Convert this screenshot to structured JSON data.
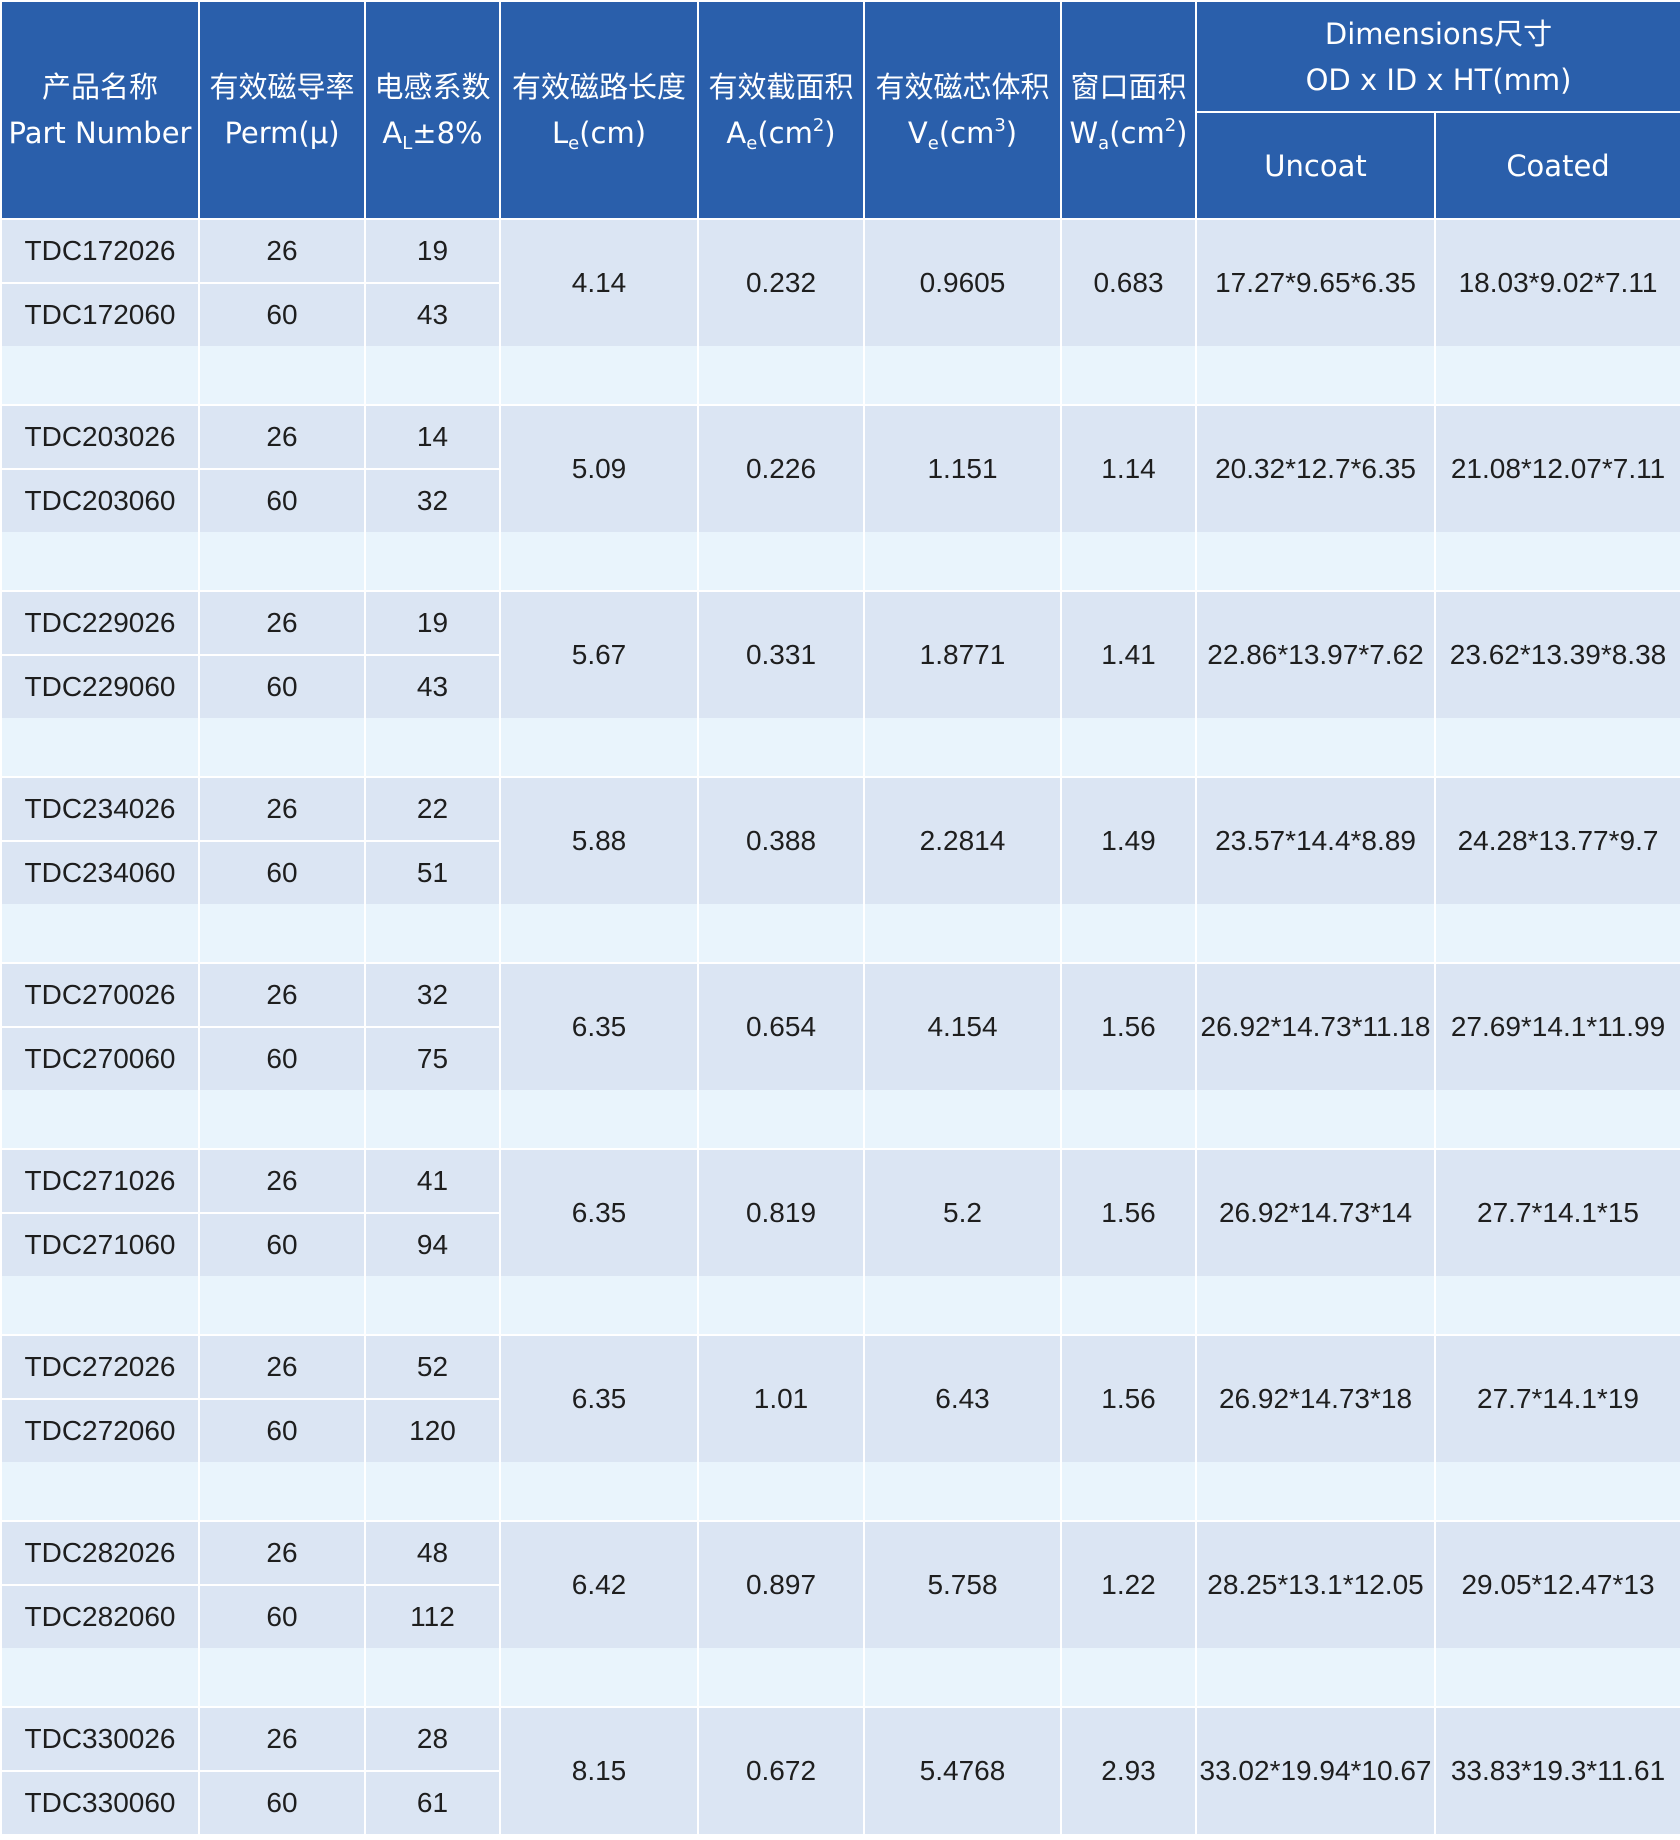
{
  "header": {
    "part": {
      "cn": "产品名称",
      "en": "Part Number"
    },
    "perm": {
      "cn": "有效磁导率",
      "en": "Perm(μ)"
    },
    "al": {
      "cn": "电感系数",
      "sym": "A",
      "sub": "L",
      "rest": "±8%"
    },
    "le": {
      "cn": "有效磁路长度",
      "sym": "L",
      "sub": "e",
      "rest": "(cm)"
    },
    "ae": {
      "cn": "有效截面积",
      "sym": "A",
      "sub": "e",
      "rest": "(cm",
      "sup": "2",
      "close": ")"
    },
    "ve": {
      "cn": "有效磁芯体积",
      "sym": "V",
      "sub": "e",
      "rest": "(cm",
      "sup": "3",
      "close": ")"
    },
    "wa": {
      "cn": "窗口面积",
      "sym": "W",
      "sub": "a",
      "rest": "(cm",
      "sup": "2",
      "close": ")"
    },
    "dims": {
      "line1": "Dimensions尺寸",
      "line2": "OD x ID x HT(mm)"
    },
    "uncoat": "Uncoat",
    "coated": "Coated"
  },
  "groups": [
    {
      "parts": [
        {
          "part": "TDC172026",
          "perm": "26",
          "al": "19"
        },
        {
          "part": "TDC172060",
          "perm": "60",
          "al": "43"
        }
      ],
      "le": "4.14",
      "ae": "0.232",
      "ve": "0.9605",
      "wa": "0.683",
      "uncoat": "17.27*9.65*6.35",
      "coated": "18.03*9.02*7.11"
    },
    {
      "parts": [
        {
          "part": "TDC203026",
          "perm": "26",
          "al": "14"
        },
        {
          "part": "TDC203060",
          "perm": "60",
          "al": "32"
        }
      ],
      "le": "5.09",
      "ae": "0.226",
      "ve": "1.151",
      "wa": "1.14",
      "uncoat": "20.32*12.7*6.35",
      "coated": "21.08*12.07*7.11"
    },
    {
      "parts": [
        {
          "part": "TDC229026",
          "perm": "26",
          "al": "19"
        },
        {
          "part": "TDC229060",
          "perm": "60",
          "al": "43"
        }
      ],
      "le": "5.67",
      "ae": "0.331",
      "ve": "1.8771",
      "wa": "1.41",
      "uncoat": "22.86*13.97*7.62",
      "coated": "23.62*13.39*8.38"
    },
    {
      "parts": [
        {
          "part": "TDC234026",
          "perm": "26",
          "al": "22"
        },
        {
          "part": "TDC234060",
          "perm": "60",
          "al": "51"
        }
      ],
      "le": "5.88",
      "ae": "0.388",
      "ve": "2.2814",
      "wa": "1.49",
      "uncoat": "23.57*14.4*8.89",
      "coated": "24.28*13.77*9.7"
    },
    {
      "parts": [
        {
          "part": "TDC270026",
          "perm": "26",
          "al": "32"
        },
        {
          "part": "TDC270060",
          "perm": "60",
          "al": "75"
        }
      ],
      "le": "6.35",
      "ae": "0.654",
      "ve": "4.154",
      "wa": "1.56",
      "uncoat": "26.92*14.73*11.18",
      "coated": "27.69*14.1*11.99"
    },
    {
      "parts": [
        {
          "part": "TDC271026",
          "perm": "26",
          "al": "41"
        },
        {
          "part": "TDC271060",
          "perm": "60",
          "al": "94"
        }
      ],
      "le": "6.35",
      "ae": "0.819",
      "ve": "5.2",
      "wa": "1.56",
      "uncoat": "26.92*14.73*14",
      "coated": "27.7*14.1*15"
    },
    {
      "parts": [
        {
          "part": "TDC272026",
          "perm": "26",
          "al": "52"
        },
        {
          "part": "TDC272060",
          "perm": "60",
          "al": "120"
        }
      ],
      "le": "6.35",
      "ae": "1.01",
      "ve": "6.43",
      "wa": "1.56",
      "uncoat": "26.92*14.73*18",
      "coated": "27.7*14.1*19"
    },
    {
      "parts": [
        {
          "part": "TDC282026",
          "perm": "26",
          "al": "48"
        },
        {
          "part": "TDC282060",
          "perm": "60",
          "al": "112"
        }
      ],
      "le": "6.42",
      "ae": "0.897",
      "ve": "5.758",
      "wa": "1.22",
      "uncoat": "28.25*13.1*12.05",
      "coated": "29.05*12.47*13"
    },
    {
      "parts": [
        {
          "part": "TDC330026",
          "perm": "26",
          "al": "28"
        },
        {
          "part": "TDC330060",
          "perm": "60",
          "al": "61"
        }
      ],
      "le": "8.15",
      "ae": "0.672",
      "ve": "5.4768",
      "wa": "2.93",
      "uncoat": "33.02*19.94*10.67",
      "coated": "33.83*19.3*11.61"
    }
  ]
}
